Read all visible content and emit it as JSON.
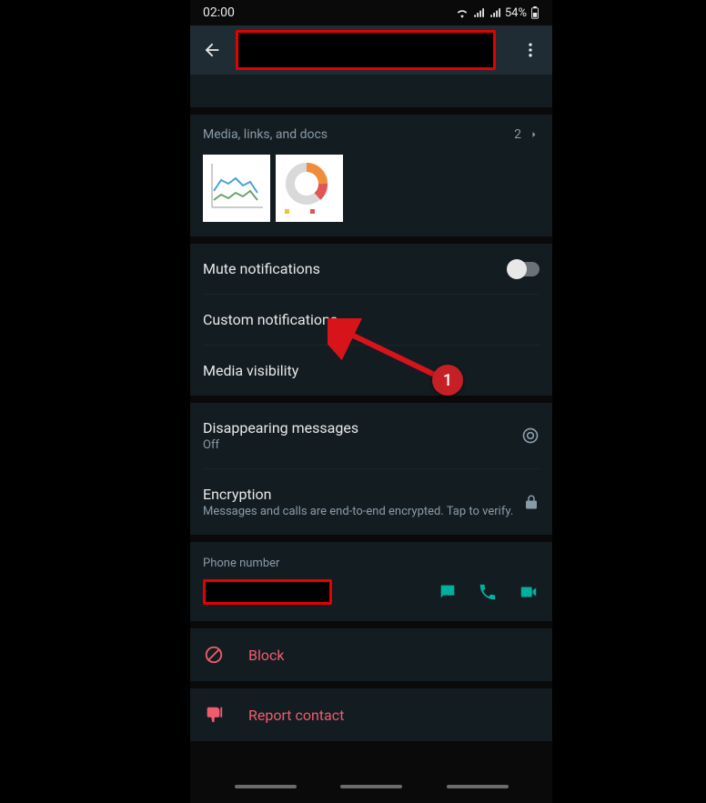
{
  "status": {
    "time": "02:00",
    "battery": "54%"
  },
  "header": {
    "title_redacted": true
  },
  "media": {
    "label": "Media, links, and docs",
    "count": "2"
  },
  "settings": {
    "mute": "Mute notifications",
    "custom_notifications": "Custom notifications",
    "media_visibility": "Media visibility",
    "disappearing": {
      "label": "Disappearing messages",
      "sub": "Off"
    },
    "encryption": {
      "label": "Encryption",
      "sub": "Messages and calls are end-to-end encrypted. Tap to verify."
    }
  },
  "phone": {
    "label": "Phone number",
    "value_redacted": true
  },
  "actions": {
    "block": "Block",
    "report": "Report contact"
  },
  "annotation": {
    "badge": "1"
  },
  "colors": {
    "accent": "#00af9c",
    "danger": "#f15c6d",
    "panel": "#131c21",
    "redact_border": "#e50000"
  }
}
